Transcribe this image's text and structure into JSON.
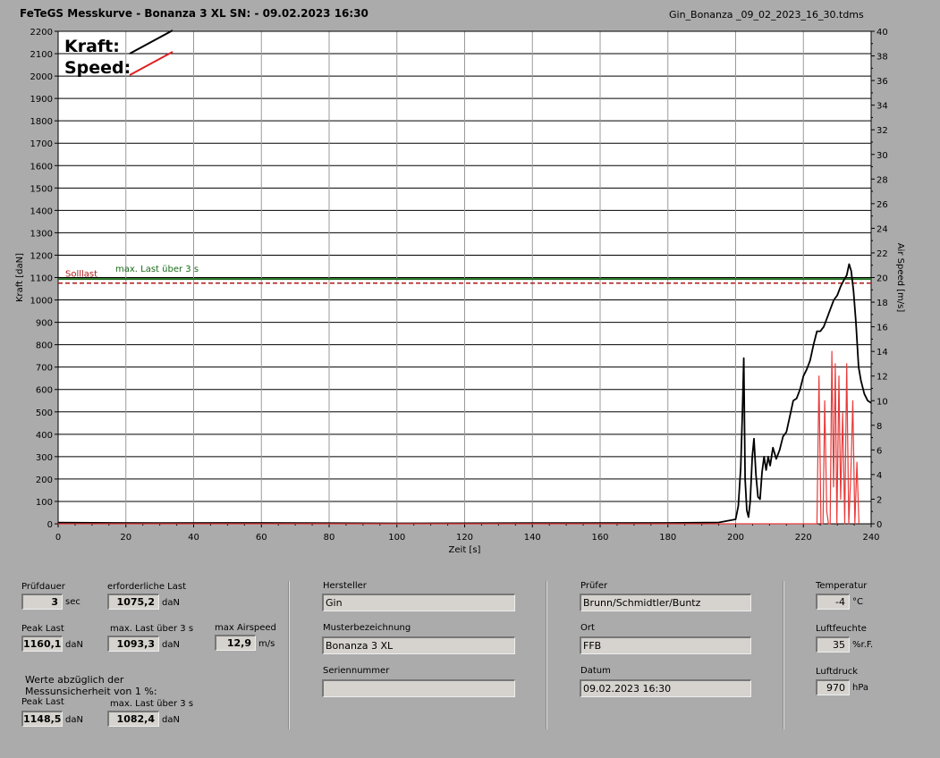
{
  "header": {
    "title": "FeTeGS Messkurve - Bonanza 3 XL  SN:  - 09.02.2023 16:30",
    "filename": "Gin_Bonanza _09_02_2023_16_30.tdms"
  },
  "chart_data": {
    "type": "line",
    "xlabel": "Zeit [s]",
    "ylabel": "Kraft [daN]",
    "y2label": "Air Speed [m/s]",
    "xlim": [
      0,
      240
    ],
    "ylim": [
      0,
      2200
    ],
    "y2lim": [
      0,
      40
    ],
    "xticks": [
      0,
      20,
      40,
      60,
      80,
      100,
      120,
      140,
      160,
      180,
      200,
      220,
      240
    ],
    "yticks": [
      0,
      100,
      200,
      300,
      400,
      500,
      600,
      700,
      800,
      900,
      1000,
      1100,
      1200,
      1300,
      1400,
      1500,
      1600,
      1700,
      1800,
      1900,
      2000,
      2100,
      2200
    ],
    "y2ticks": [
      0,
      2,
      4,
      6,
      8,
      10,
      12,
      14,
      16,
      18,
      20,
      22,
      24,
      26,
      28,
      30,
      32,
      34,
      36,
      38,
      40
    ],
    "grid": true,
    "legend_position": "top-left",
    "legend": [
      {
        "label": "Kraft:",
        "color": "#000000"
      },
      {
        "label": "Speed:",
        "color": "#e02020"
      }
    ],
    "reference_lines": [
      {
        "label": "max. Last über  3 s",
        "y": 1093.3,
        "color": "#1a6b1a",
        "style": "solid"
      },
      {
        "label": "Solllast",
        "y": 1075.2,
        "color": "#b01818",
        "style": "dashed"
      }
    ],
    "series": [
      {
        "name": "Kraft:",
        "axis": "left",
        "color": "#000000",
        "x": [
          0,
          30,
          60,
          100,
          140,
          180,
          195,
          200,
          200.8,
          201.5,
          202.0,
          202.4,
          202.8,
          203.3,
          203.8,
          204.3,
          204.9,
          205.4,
          206.0,
          206.6,
          207.2,
          207.8,
          208.4,
          209.0,
          209.6,
          210.2,
          211,
          212,
          213,
          214,
          215,
          216,
          217,
          218,
          219,
          220,
          221,
          222,
          223,
          224,
          225,
          226,
          227,
          228,
          229,
          230,
          231,
          232,
          232.8,
          233.5,
          234.1,
          234.8,
          235.5,
          236.3,
          237,
          238,
          239,
          240
        ],
        "y": [
          5,
          3,
          4,
          2,
          3,
          4,
          6,
          20,
          80,
          250,
          500,
          740,
          200,
          60,
          30,
          100,
          300,
          380,
          220,
          120,
          110,
          230,
          300,
          240,
          300,
          260,
          340,
          290,
          330,
          390,
          410,
          480,
          550,
          560,
          600,
          660,
          690,
          730,
          800,
          860,
          860,
          880,
          920,
          960,
          1000,
          1020,
          1060,
          1090,
          1110,
          1160,
          1130,
          1040,
          900,
          700,
          640,
          580,
          550,
          540
        ]
      },
      {
        "name": "Speed:",
        "axis": "right",
        "color": "#e83a3a",
        "x": [
          0,
          200,
          205,
          210,
          215,
          220,
          224,
          224.6,
          225.2,
          225.8,
          226.3,
          226.9,
          227.4,
          227.9,
          228.4,
          228.9,
          229.4,
          229.9,
          230.5,
          231,
          231.6,
          232.2,
          232.8,
          233.4,
          234,
          234.6,
          235.2,
          235.8,
          236.4
        ],
        "y": [
          0,
          0,
          0,
          0,
          0,
          0,
          0,
          12,
          0,
          0,
          10,
          1,
          0,
          0,
          14,
          3,
          13,
          0,
          12,
          2,
          9,
          0,
          13,
          0,
          4,
          10,
          0,
          5,
          0
        ]
      }
    ]
  },
  "fields": {
    "pruefdauer": {
      "label": "Prüfdauer",
      "value": "3",
      "unit": "sec"
    },
    "erforderliche_last": {
      "label": "erforderliche Last",
      "value": "1075,2",
      "unit": "daN"
    },
    "peak_last": {
      "label": "Peak Last",
      "value": "1160,1",
      "unit": "daN"
    },
    "max_last": {
      "label": "max. Last über  3 s",
      "value": "1093,3",
      "unit": "daN"
    },
    "max_airspeed": {
      "label": "max Airspeed",
      "value": "12,9",
      "unit": "m/s"
    },
    "werte_note_line1": "Werte abzüglich der",
    "werte_note_line2": "Messunsicherheit von 1  %:",
    "peak_last_korr": {
      "label": "Peak Last",
      "value": "1148,5",
      "unit": "daN"
    },
    "max_last_korr": {
      "label": "max. Last über  3 s",
      "value": "1082,4",
      "unit": "daN"
    },
    "hersteller": {
      "label": "Hersteller",
      "value": "Gin"
    },
    "musterbezeichnung": {
      "label": "Musterbezeichnung",
      "value": "Bonanza 3 XL"
    },
    "seriennummer": {
      "label": "Seriennummer",
      "value": ""
    },
    "pruefer": {
      "label": "Prüfer",
      "value": "Brunn/Schmidtler/Buntz"
    },
    "ort": {
      "label": "Ort",
      "value": "FFB"
    },
    "datum": {
      "label": "Datum",
      "value": "09.02.2023 16:30"
    },
    "temperatur": {
      "label": "Temperatur",
      "value": "-4",
      "unit": "°C"
    },
    "luftfeuchte": {
      "label": "Luftfeuchte",
      "value": "35",
      "unit": "%r.F."
    },
    "luftdruck": {
      "label": "Luftdruck",
      "value": "970",
      "unit": "hPa"
    }
  }
}
